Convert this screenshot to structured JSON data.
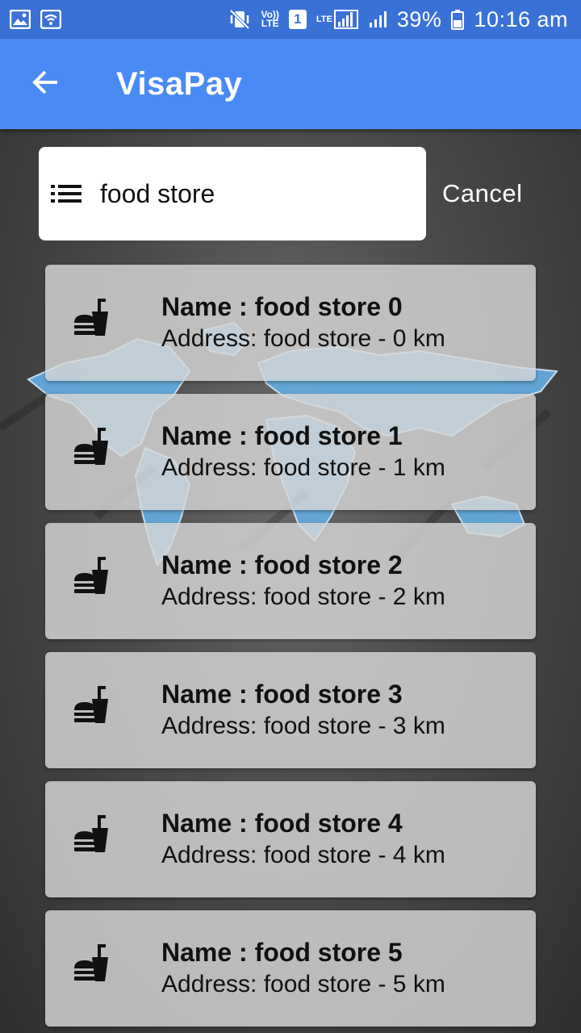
{
  "status_bar": {
    "volte_label": "Vo))\nLTE",
    "sim_number": "1",
    "lte_label": "LTE",
    "battery": "39%",
    "time": "10:16 am"
  },
  "app_bar": {
    "title": "VisaPay"
  },
  "search": {
    "value": "food store",
    "cancel_label": "Cancel"
  },
  "stores": [
    {
      "name": "Name : food store 0",
      "address": "Address: food store - 0 km"
    },
    {
      "name": "Name : food store 1",
      "address": "Address: food store - 1 km"
    },
    {
      "name": "Name : food store 2",
      "address": "Address: food store - 2 km"
    },
    {
      "name": "Name : food store 3",
      "address": "Address: food store - 3 km"
    },
    {
      "name": "Name : food store 4",
      "address": "Address: food store - 4 km"
    },
    {
      "name": "Name : food store 5",
      "address": "Address: food store - 5 km"
    }
  ],
  "icons": {
    "back": "arrow-back-icon",
    "menu": "list-menu-icon",
    "store": "fastfood-icon"
  },
  "colors": {
    "status_bar": "#3a71d6",
    "app_bar": "#4a8af4",
    "map_blue": "#5fa8dc"
  }
}
